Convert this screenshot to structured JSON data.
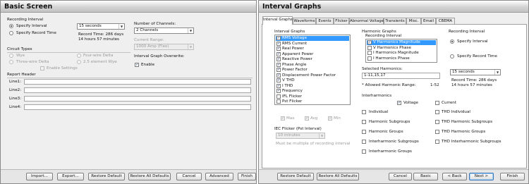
{
  "basic": {
    "title": "Basic Screen",
    "recording_interval": {
      "heading": "Recording Interval",
      "options": [
        "Specify Interval",
        "Specify Record Time"
      ],
      "selected": 0,
      "interval_value": "15 seconds",
      "record_time_line1": "Record Time: 286 days",
      "record_time_line2": "14 hours 57 minutes"
    },
    "channels": {
      "label": "Number of Channels:",
      "value": "2 Channels"
    },
    "current_range": {
      "label": "Current Range:",
      "value": "1000 Amp (Flex)"
    },
    "overwrite": {
      "label": "Interval Graph Overwrite:",
      "enable_label": "Enable",
      "checked": true
    },
    "circuit_types": {
      "heading": "Circuit Types",
      "options": [
        "Wye",
        "Four-wire Delta",
        "Three-wire Delta",
        "2.5 element Wye"
      ],
      "enable_settings": "Enable Settings"
    },
    "report_header": {
      "heading": "Report Header",
      "lines": [
        "Line1:",
        "Line2:",
        "Line3:",
        "Line4:"
      ]
    },
    "buttons": [
      "Import...",
      "Export...",
      "Restore Default",
      "Restore All Defaults",
      "Cancel",
      "Advanced",
      "Finish"
    ]
  },
  "interval": {
    "title": "Interval Graphs",
    "tabs": [
      "Interval Graphs",
      "Waveforms",
      "Events",
      "Flicker",
      "Abnormal Voltage",
      "Transients",
      "Misc.",
      "Email",
      "CBEMA"
    ],
    "active_tab": 0,
    "graphs": {
      "heading": "Interval Graphs",
      "items": [
        "RMS Voltage",
        "RMS Current",
        "Real Power",
        "Apparent Power",
        "Reactive Power",
        "Phase Angle",
        "Power Factor",
        "Displacement Power Factor",
        "V THD",
        "I THD",
        "Frequency",
        "IFL Flicker",
        "Pst Flicker"
      ],
      "checked": [
        true,
        true,
        true,
        true,
        true,
        true,
        true,
        true,
        true,
        true,
        true,
        false,
        false
      ],
      "selected": 0,
      "stats": [
        "Max",
        "Avg",
        "Min"
      ]
    },
    "harmonic": {
      "heading": "Harmonic Graphs",
      "sub": "Recording Interval",
      "items": [
        "V Harmonics Magnitude",
        "V Harmonics Phase",
        "I Harmonics Magnitude",
        "I Harmonics Phase"
      ],
      "checked": [
        true,
        false,
        false,
        false
      ],
      "selected": 0,
      "selected_label": "Selected Harmonics:",
      "selected_value": "1-11,15,17",
      "allowed_label": "* Allowed Harmonic Range:",
      "allowed_value": "1-52"
    },
    "recording": {
      "heading": "Recording Interval",
      "options": [
        "Specify Interval",
        "Specify Record Time"
      ],
      "selected": 0,
      "interval_value": "15 seconds",
      "record_time_line1": "Record Time: 286 days",
      "record_time_line2": "14 hours 57 minutes"
    },
    "pst": {
      "heading": "IEC Flicker (Pst Interval)",
      "value": "10 minutes",
      "note": "Must be multiple of recording interval"
    },
    "interharmonics": {
      "heading": "Interharmonics",
      "voltage": "Voltage",
      "current": "Current",
      "left": [
        "Individual",
        "Harmonic Subgroups",
        "Harmonic Groups",
        "Interharmonic Subgroups",
        "Interharmonic Groups"
      ],
      "right": [
        "THD Individual",
        "THD Harmonic Subgroups",
        "THD Harmonic Groups",
        "THD Interharmonic Subgroups"
      ]
    },
    "buttons": [
      "Restore Default",
      "Restore All Defaults",
      "Cancel",
      "Basic",
      "< Back",
      "Next >",
      "Finish"
    ]
  }
}
